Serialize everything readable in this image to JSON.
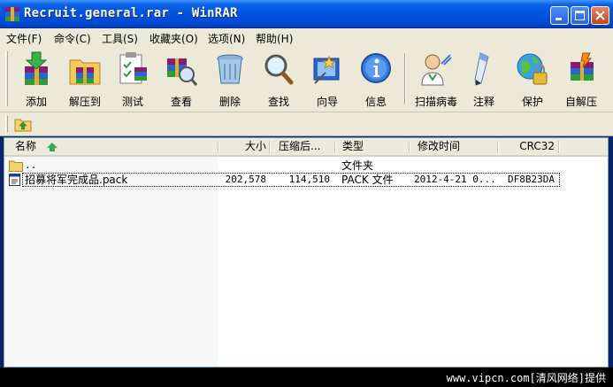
{
  "window": {
    "title": "Recruit.general.rar - WinRAR",
    "controls": {
      "minimize": "minimize-icon",
      "maximize": "maximize-icon",
      "close": "close-icon"
    }
  },
  "menu": [
    {
      "label": "文件(F)"
    },
    {
      "label": "命令(C)"
    },
    {
      "label": "工具(S)"
    },
    {
      "label": "收藏夹(O)"
    },
    {
      "label": "选项(N)"
    },
    {
      "label": "帮助(H)"
    }
  ],
  "toolbar": {
    "buttons": [
      {
        "label": "添加",
        "icon": "add-archive-icon"
      },
      {
        "label": "解压到",
        "icon": "extract-to-icon"
      },
      {
        "label": "测试",
        "icon": "test-icon"
      },
      {
        "label": "查看",
        "icon": "view-icon"
      },
      {
        "label": "删除",
        "icon": "delete-icon"
      },
      {
        "label": "查找",
        "icon": "find-icon"
      },
      {
        "label": "向导",
        "icon": "wizard-icon"
      },
      {
        "label": "信息",
        "icon": "info-icon"
      },
      {
        "label": "扫描病毒",
        "icon": "virus-scan-icon"
      },
      {
        "label": "注释",
        "icon": "comment-icon"
      },
      {
        "label": "保护",
        "icon": "protect-icon"
      },
      {
        "label": "自解压",
        "icon": "sfx-icon"
      }
    ]
  },
  "address": {
    "up_icon": "folder-up-icon"
  },
  "list": {
    "columns": [
      {
        "label": "名称",
        "sorted": true
      },
      {
        "label": "大小"
      },
      {
        "label": "压缩后..."
      },
      {
        "label": "类型"
      },
      {
        "label": "修改时间"
      },
      {
        "label": "CRC32"
      }
    ],
    "rows": [
      {
        "name": "..",
        "size": "",
        "packed": "",
        "type": "文件夹",
        "modified": "",
        "crc": "",
        "icon": "folder-icon"
      },
      {
        "name": "招募将军完成品.pack",
        "size": "202,578",
        "packed": "114,510",
        "type": "PACK 文件",
        "modified": "2012-4-21 0...",
        "crc": "DF8B23DA",
        "icon": "file-icon"
      }
    ]
  },
  "watermark": {
    "text": "www.vipcn.com[清风网络]提供"
  }
}
